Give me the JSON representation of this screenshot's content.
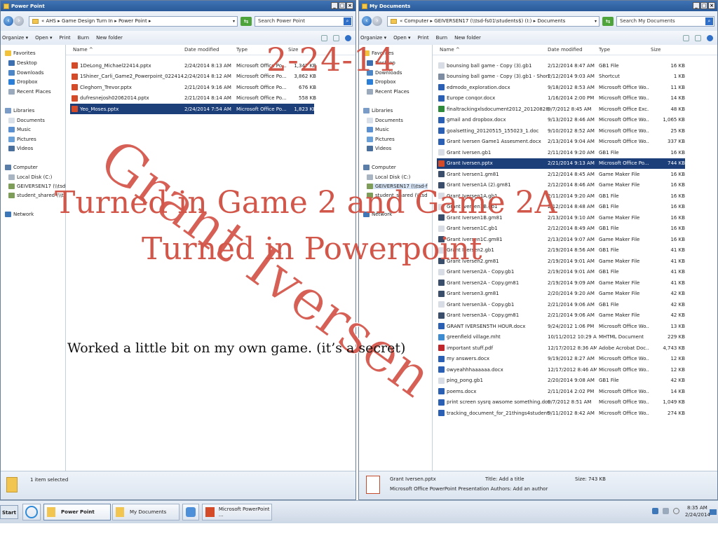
{
  "left_window": {
    "title": "Power Point",
    "address": "« AHS ▸ Game Design Turn In ▸ Power Point ▸",
    "search_placeholder": "Search Power Point",
    "toolbar": {
      "organize": "Organize ▾",
      "open": "Open ▾",
      "print": "Print",
      "burn": "Burn",
      "new_folder": "New folder"
    },
    "nav": {
      "favorites": "Favorites",
      "favorite_items": [
        "Desktop",
        "Downloads",
        "Dropbox",
        "Recent Places"
      ],
      "libraries": "Libraries",
      "library_items": [
        "Documents",
        "Music",
        "Pictures",
        "Videos"
      ],
      "computer": "Computer",
      "computer_items": [
        "Local Disk (C:)",
        "GEIVERSEN17 (\\\\tsd-f",
        "student_shared (\\\\ts"
      ],
      "network": "Network"
    },
    "columns": {
      "name": "Name ^",
      "date": "Date modified",
      "type": "Type",
      "size": "Size"
    },
    "files": [
      {
        "name": "1DeLong_Michael22414.pptx",
        "date": "2/24/2014 8:13 AM",
        "type": "Microsoft Office Po...",
        "size": "1,347 KB"
      },
      {
        "name": "1Shiner_Carli_Game2_Powerpoint_022414.p...",
        "date": "2/24/2014 8:12 AM",
        "type": "Microsoft Office Po...",
        "size": "3,862 KB"
      },
      {
        "name": "Cleghorn_Trevor.pptx",
        "date": "2/21/2014 9:16 AM",
        "type": "Microsoft Office Po...",
        "size": "676 KB"
      },
      {
        "name": "dufresnejosh02062014.pptx",
        "date": "2/21/2014 8:14 AM",
        "type": "Microsoft Office Po...",
        "size": "558 KB"
      },
      {
        "name": "Yeo_Moses.pptx",
        "date": "2/24/2014 7:54 AM",
        "type": "Microsoft Office Po...",
        "size": "1,823 KB",
        "selected": true
      }
    ],
    "status": "1 item selected"
  },
  "right_window": {
    "title": "My Documents",
    "address": "« Computer ▸ GEIVERSEN17 (\\\\tsd-fs01\\students$) (I:) ▸ Documents",
    "search_placeholder": "Search My Documents",
    "toolbar": {
      "organize": "Organize ▾",
      "open": "Open ▾",
      "print": "Print",
      "burn": "Burn",
      "new_folder": "New folder"
    },
    "nav": {
      "favorites": "Favorites",
      "favorite_items": [
        "Desktop",
        "Downloads",
        "Dropbox",
        "Recent Places"
      ],
      "libraries": "Libraries",
      "library_items": [
        "Documents",
        "Music",
        "Pictures",
        "Videos"
      ],
      "computer": "Computer",
      "computer_items": [
        "Local Disk (C:)",
        "GEIVERSEN17 (\\\\tsd-f",
        "student_shared (\\\\tsd"
      ],
      "network": "Network"
    },
    "columns": {
      "name": "Name ^",
      "date": "Date modified",
      "type": "Type",
      "size": "Size"
    },
    "files": [
      {
        "name": "bounsing ball game - Copy (3).gb1",
        "date": "2/12/2014 8:47 AM",
        "type": "GB1 File",
        "size": "16 KB"
      },
      {
        "name": "bounsing ball game - Copy (3).gb1 - Shortcut",
        "date": "2/12/2014 9:03 AM",
        "type": "Shortcut",
        "size": "1 KB"
      },
      {
        "name": "edmodo_exploration.docx",
        "date": "9/18/2012 8:53 AM",
        "type": "Microsoft Office Wo...",
        "size": "11 KB"
      },
      {
        "name": "Europe conqor.docx",
        "date": "1/16/2014 2:00 PM",
        "type": "Microsoft Office Wo...",
        "size": "14 KB"
      },
      {
        "name": "finaltrackingxlsdocument2012_20120828_12...",
        "date": "9/7/2012 8:45 AM",
        "type": "Microsoft Office Exc...",
        "size": "48 KB"
      },
      {
        "name": "gmail and dropbox.docx",
        "date": "9/13/2012 8:46 AM",
        "type": "Microsoft Office Wo...",
        "size": "1,065 KB"
      },
      {
        "name": "goalsetting_20120515_155023_1.doc",
        "date": "9/10/2012 8:52 AM",
        "type": "Microsoft Office Wo...",
        "size": "25 KB"
      },
      {
        "name": "Grant Iversen Game1 Assesment.docx",
        "date": "2/13/2014 9:04 AM",
        "type": "Microsoft Office Wo...",
        "size": "337 KB"
      },
      {
        "name": "Grant Iversen.gb1",
        "date": "2/11/2014 9:20 AM",
        "type": "GB1 File",
        "size": "16 KB"
      },
      {
        "name": "Grant Iversen.pptx",
        "date": "2/21/2014 9:13 AM",
        "type": "Microsoft Office Po...",
        "size": "744 KB",
        "selected": true
      },
      {
        "name": "Grant Iversen1.gm81",
        "date": "2/12/2014 8:45 AM",
        "type": "Game Maker File",
        "size": "16 KB"
      },
      {
        "name": "Grant Iversen1A (2).gm81",
        "date": "2/12/2014 8:46 AM",
        "type": "Game Maker File",
        "size": "16 KB"
      },
      {
        "name": "Grant Iversen1A.gb1",
        "date": "2/11/2014 9:20 AM",
        "type": "GB1 File",
        "size": "16 KB"
      },
      {
        "name": "Grant Iversen1B.gb1",
        "date": "2/12/2014 8:48 AM",
        "type": "GB1 File",
        "size": "16 KB"
      },
      {
        "name": "Grant Iversen1B.gm81",
        "date": "2/13/2014 9:10 AM",
        "type": "Game Maker File",
        "size": "16 KB"
      },
      {
        "name": "Grant Iversen1C.gb1",
        "date": "2/12/2014 8:49 AM",
        "type": "GB1 File",
        "size": "16 KB"
      },
      {
        "name": "Grant Iversen1C.gm81",
        "date": "2/13/2014 9:07 AM",
        "type": "Game Maker File",
        "size": "16 KB"
      },
      {
        "name": "Grant Iversen2.gb1",
        "date": "2/19/2014 8:56 AM",
        "type": "GB1 File",
        "size": "41 KB"
      },
      {
        "name": "Grant Iversen2.gm81",
        "date": "2/19/2014 9:01 AM",
        "type": "Game Maker File",
        "size": "41 KB"
      },
      {
        "name": "Grant Iversen2A - Copy.gb1",
        "date": "2/19/2014 9:01 AM",
        "type": "GB1 File",
        "size": "41 KB"
      },
      {
        "name": "Grant Iversen2A - Copy.gm81",
        "date": "2/19/2014 9:09 AM",
        "type": "Game Maker File",
        "size": "41 KB"
      },
      {
        "name": "Grant Iversen3.gm81",
        "date": "2/20/2014 9:20 AM",
        "type": "Game Maker File",
        "size": "42 KB"
      },
      {
        "name": "Grant Iversen3A - Copy.gb1",
        "date": "2/21/2014 9:06 AM",
        "type": "GB1 File",
        "size": "42 KB"
      },
      {
        "name": "Grant Iversen3A - Copy.gm81",
        "date": "2/21/2014 9:06 AM",
        "type": "Game Maker File",
        "size": "42 KB"
      },
      {
        "name": "GRANT IVERSEN5TH HOUR.docx",
        "date": "9/24/2012 1:06 PM",
        "type": "Microsoft Office Wo...",
        "size": "13 KB"
      },
      {
        "name": "greenfield village.mht",
        "date": "10/11/2012 10:29 AM",
        "type": "MHTML Document",
        "size": "229 KB"
      },
      {
        "name": "important stuff.pdf",
        "date": "12/17/2012 8:36 AM",
        "type": "Adobe Acrobat Doc...",
        "size": "4,743 KB"
      },
      {
        "name": "my answers.docx",
        "date": "9/19/2012 8:27 AM",
        "type": "Microsoft Office Wo...",
        "size": "12 KB"
      },
      {
        "name": "owyeahhhaaaaaa.docx",
        "date": "12/17/2012 8:46 AM",
        "type": "Microsoft Office Wo...",
        "size": "12 KB"
      },
      {
        "name": "ping_pong.gb1",
        "date": "2/20/2014 9:08 AM",
        "type": "GB1 File",
        "size": "42 KB"
      },
      {
        "name": "poems.docx",
        "date": "2/11/2014 2:02 PM",
        "type": "Microsoft Office Wo...",
        "size": "14 KB"
      },
      {
        "name": "print screen sysrq awsome something.docx",
        "date": "9/7/2012 8:51 AM",
        "type": "Microsoft Office Wo...",
        "size": "1,049 KB"
      },
      {
        "name": "tracking_document_for_21things4students.doc",
        "date": "9/11/2012 8:42 AM",
        "type": "Microsoft Office Wo...",
        "size": "274 KB"
      }
    ],
    "details": {
      "filename": "Grant Iversen.pptx",
      "title_label": "Title: Add a title",
      "size_label": "Size: 743 KB",
      "type_desc": "Microsoft Office PowerPoint Presentation Authors: Add an author"
    }
  },
  "taskbar": {
    "start": "Start",
    "tasks": [
      "Power Point",
      "My Documents",
      "Microsoft PowerPoint ..."
    ],
    "time": "8:35 AM",
    "date": "2/24/2014"
  },
  "slide_overlay": {
    "date_text": "2-24-14",
    "line1": "Turned in Game 2 and Game 2A",
    "line2": "Turned in Powerpoint",
    "small_text": "Worked a little bit on my own game. (it’s a secret)",
    "watermark": "Grant Iversen"
  },
  "colors": {
    "accent_red": "#d2574b",
    "selection_blue": "#1c3f7a",
    "titlebar_blue": "#2a5a9a"
  }
}
